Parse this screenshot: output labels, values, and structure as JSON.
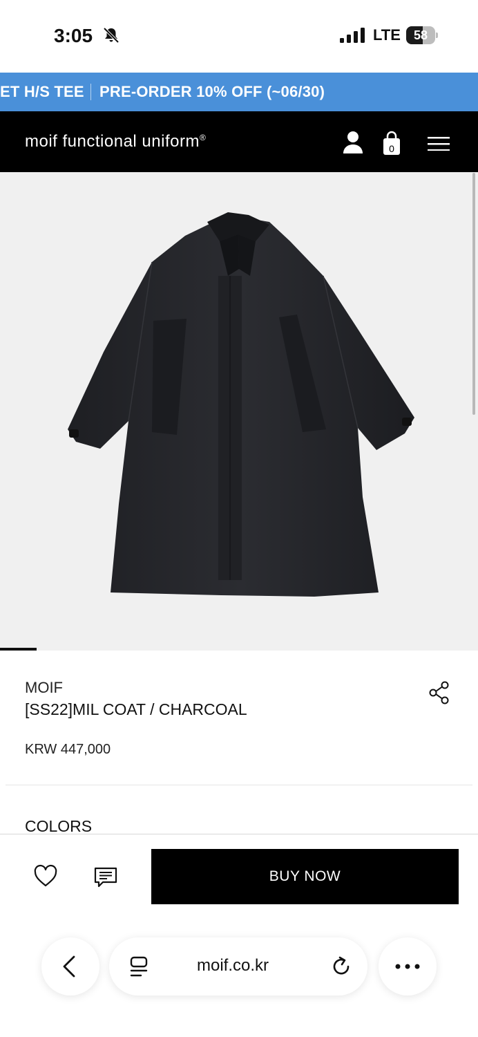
{
  "status_bar": {
    "time": "3:05",
    "network": "LTE",
    "battery": "58",
    "battery_level": 0.58,
    "icons": [
      "bell-off-icon",
      "signal-icon",
      "battery-icon"
    ]
  },
  "promo": {
    "items": [
      "ET H/S TEE",
      "PRE-ORDER 10% OFF (~06/30)"
    ],
    "color": "#4a90d9"
  },
  "header": {
    "logo": "moif functional uniform",
    "logo_mark": "®",
    "cart_count": "0",
    "icons": [
      "user-icon",
      "shopping-bag-icon",
      "menu-icon"
    ]
  },
  "product": {
    "brand": "MOIF",
    "name": "[SS22]MIL COAT / CHARCOAL",
    "price": "KRW 447,000",
    "colors_label": "COLORS",
    "image": "charcoal-coat-photo"
  },
  "actions": {
    "buy_label": "BUY NOW",
    "icons": [
      "heart-icon",
      "chat-icon",
      "share-icon"
    ]
  },
  "browser": {
    "url": "moif.co.kr",
    "icons": [
      "back-icon",
      "tabs-icon",
      "reload-icon",
      "more-icon"
    ]
  }
}
